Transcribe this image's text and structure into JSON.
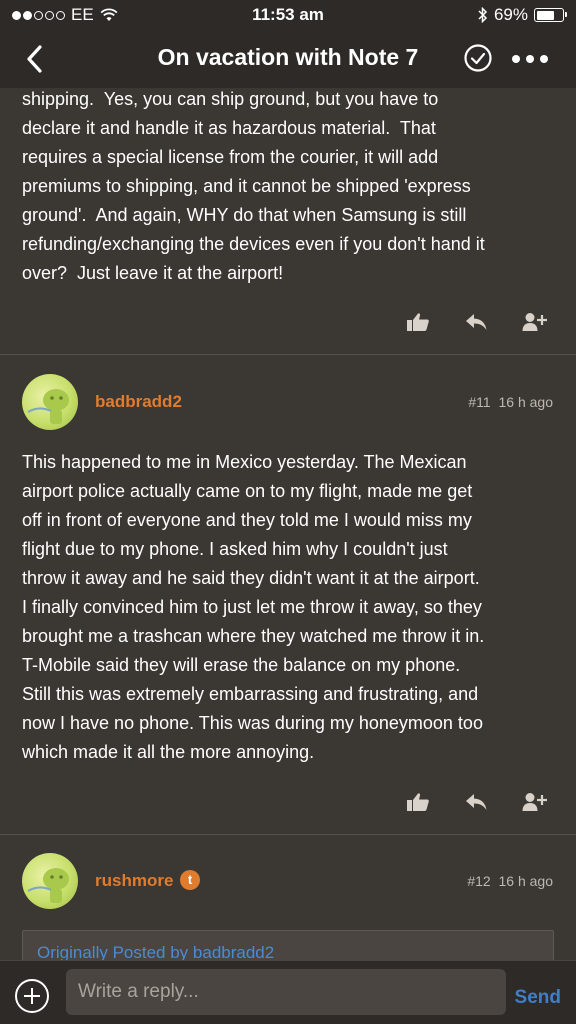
{
  "status_bar": {
    "carrier": "EE",
    "time": "11:53 am",
    "battery": "69%",
    "battery_level": 0.69,
    "signal_bars": 2
  },
  "nav": {
    "title": "On vacation with Note 7",
    "icons": [
      "back-icon",
      "check-circle-icon",
      "more-icon"
    ]
  },
  "posts": [
    {
      "text_lines": [
        "shipping.  Yes, you can ship ground, but you have to",
        "declare it and handle it as hazardous material.  That",
        "requires a special license from the courier, it will add",
        "premiums to shipping, and it cannot be shipped 'express",
        "ground'.  And again, WHY do that when Samsung is still",
        "refunding/exchanging the devices even if you don't hand it",
        "over?  Just leave it at the airport!"
      ]
    },
    {
      "username": "badbradd2",
      "number": "#11",
      "time": "16 h ago",
      "text_lines": [
        "This happened to me in Mexico yesterday. The Mexican",
        "airport police actually came on to my flight, made me get",
        "off in front of everyone and they told me I would miss my",
        "flight due to my phone. I asked him why I couldn't just",
        "throw it away and he said they didn't want it at the airport.",
        "I finally convinced him to just let me throw it away, so they",
        "brought me a trashcan where they watched me throw it in.",
        "T-Mobile said they will erase the balance on my phone.",
        "Still this was extremely embarrassing and frustrating, and",
        "now I have no phone. This was during my honeymoon too",
        "which made it all the more annoying."
      ]
    },
    {
      "username": "rushmore",
      "badge": "t",
      "number": "#12",
      "time": "16 h ago",
      "quote_label": "Originally Posted by badbradd2"
    }
  ],
  "reply": {
    "placeholder": "Write a reply...",
    "send_label": "Send"
  },
  "colors": {
    "background": "#3b3733",
    "bar": "#2d2a27",
    "username": "#e07c2e",
    "link": "#3f7fc8"
  }
}
